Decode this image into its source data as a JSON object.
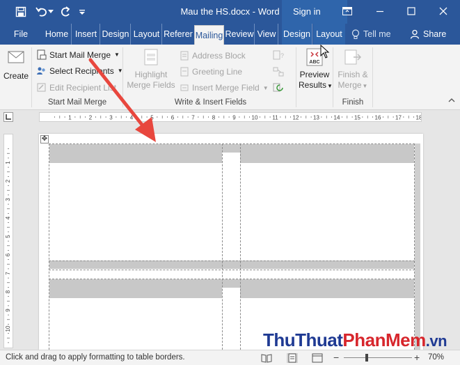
{
  "app": {
    "title": "Mau the HS.docx - Word",
    "sign_in": "Sign in"
  },
  "quick_access": {
    "icons": [
      "save-icon",
      "undo-icon",
      "redo-icon",
      "customize-qat-icon"
    ]
  },
  "window_controls": {
    "icons": [
      "ribbon-display-icon",
      "minimize-icon",
      "maximize-icon",
      "close-icon"
    ]
  },
  "tabs": [
    {
      "label": "File"
    },
    {
      "label": "Home"
    },
    {
      "label": "Insert"
    },
    {
      "label": "Design"
    },
    {
      "label": "Layout"
    },
    {
      "label": "Referer"
    },
    {
      "label": "Mailing",
      "active": true
    },
    {
      "label": "Review"
    },
    {
      "label": "View"
    },
    {
      "label": "Design",
      "contextual": true
    },
    {
      "label": "Layout",
      "contextual": true
    }
  ],
  "tell_me": "Tell me",
  "share": "Share",
  "ribbon": {
    "create": {
      "label": "Create"
    },
    "start_mail_merge": {
      "group_label": "Start Mail Merge",
      "start_mail_merge": "Start Mail Merge",
      "select_recipients": "Select Recipients",
      "edit_recipient_list": "Edit Recipient List"
    },
    "write_insert": {
      "group_label": "Write & Insert Fields",
      "highlight_1": "Highlight",
      "highlight_2": "Merge Fields",
      "address_block": "Address Block",
      "greeting_line": "Greeting Line",
      "insert_merge_field": "Insert Merge Field"
    },
    "preview": {
      "label_1": "Preview",
      "label_2": "Results",
      "icon_text": "ABC"
    },
    "finish": {
      "group_label": "Finish",
      "label_1": "Finish &",
      "label_2": "Merge"
    }
  },
  "ruler": {
    "h_labels": [
      "1",
      "2",
      "3",
      "4",
      "5",
      "6",
      "7",
      "8",
      "9",
      "10",
      "11",
      "12",
      "13",
      "14",
      "15",
      "16",
      "17",
      "18"
    ],
    "v_labels": [
      "1",
      "2",
      "3",
      "4",
      "5",
      "6",
      "7",
      "8",
      "9",
      "10",
      "11"
    ]
  },
  "status": {
    "text": "Click and drag to apply formatting to table borders.",
    "zoom": "70%",
    "zoom_minus": "−",
    "zoom_plus": "+"
  },
  "watermark": {
    "part1": "ThuThuat",
    "part2": "PhanMem",
    "part3": ".vn"
  },
  "colors": {
    "title_bar": "#2b579a",
    "ribbon_bg": "#f3f3f3",
    "arrow": "#e8473e",
    "table_header_shading": "#c8c8c8"
  }
}
